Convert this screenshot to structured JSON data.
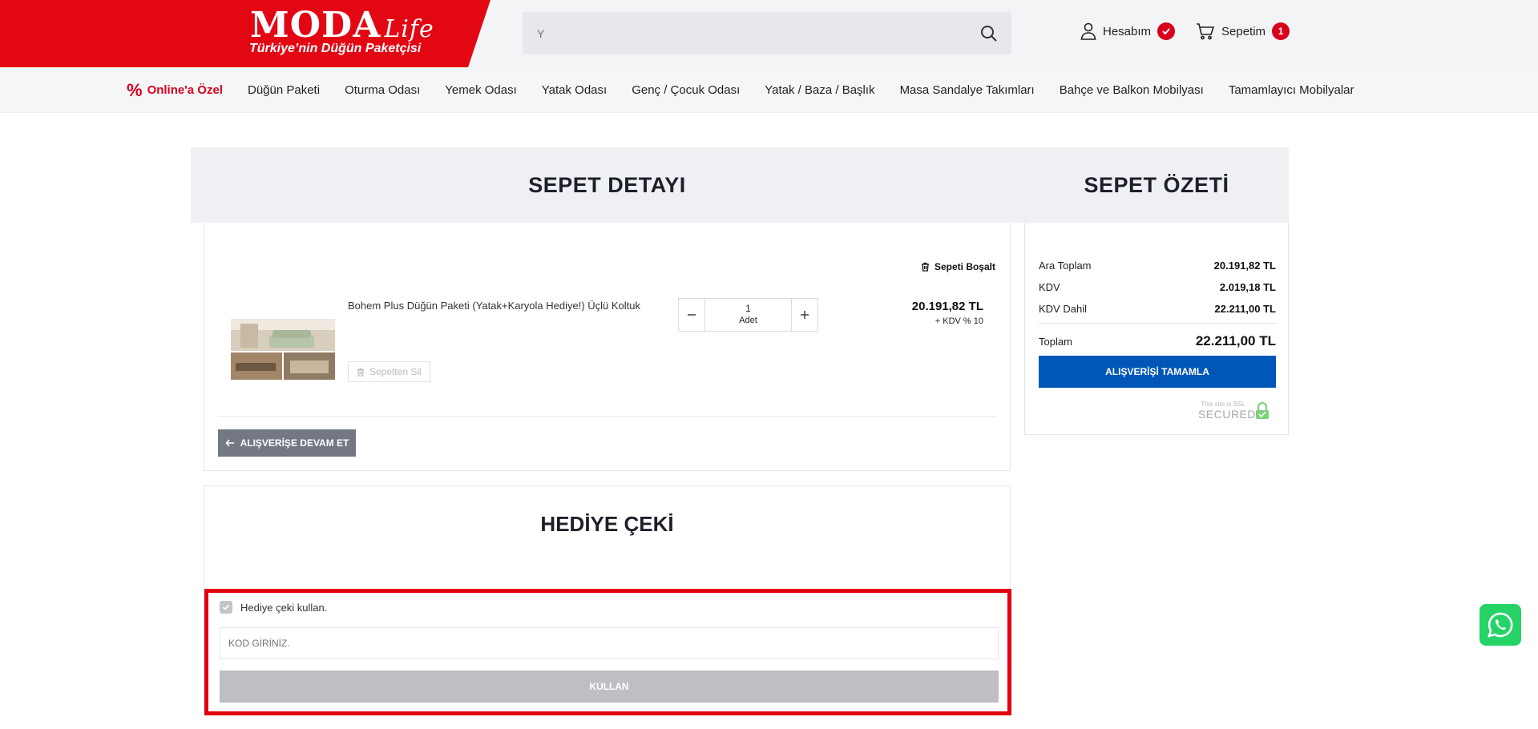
{
  "header": {
    "logo_main": "MODA",
    "logo_script": "Life",
    "logo_tagline": "Türkiye’nin Düğün Paketçisi",
    "search_placeholder": "Y",
    "account_label": "Hesabım",
    "cart_label": "Sepetim",
    "cart_count": "1"
  },
  "nav": {
    "special_label": "Online'a Özel",
    "items": [
      "Düğün Paketi",
      "Oturma Odası",
      "Yemek Odası",
      "Yatak Odası",
      "Genç / Çocuk Odası",
      "Yatak / Baza / Başlık",
      "Masa Sandalye Takımları",
      "Bahçe ve Balkon Mobilyası",
      "Tamamlayıcı Mobilyalar"
    ]
  },
  "cart": {
    "title": "SEPET DETAYI",
    "empty_label": "Sepeti Boşalt",
    "product_name": "Bohem Plus Düğün Paketi (Yatak+Karyola Hediye!) Üçlü Koltuk",
    "remove_label": "Sepetten Sil",
    "quantity": "1",
    "quantity_unit": "Adet",
    "price": "20.191,82 TL",
    "vat_note": "+ KDV % 10",
    "continue_label": "ALIŞVERİŞE DEVAM ET"
  },
  "summary": {
    "title": "SEPET ÖZETİ",
    "subtotal_label": "Ara Toplam",
    "subtotal_value": "20.191,82 TL",
    "vat_label": "KDV",
    "vat_value": "2.019,18 TL",
    "vat_incl_label": "KDV Dahil",
    "vat_incl_value": "22.211,00 TL",
    "total_label": "Toplam",
    "total_value": "22.211,00 TL",
    "checkout_label": "ALIŞVERİŞİ TAMAMLA",
    "ssl_small": "This site is SSL",
    "ssl_big": "SECURED"
  },
  "gift": {
    "title": "HEDİYE ÇEKİ",
    "checkbox_label": "Hediye çeki kullan.",
    "code_placeholder": "KOD GİRİNİZ.",
    "use_label": "KULLAN"
  },
  "colors": {
    "brand_red": "#e30613",
    "checkout_blue": "#0057b8",
    "highlight_red": "#e1000f",
    "whatsapp_green": "#25d366"
  }
}
